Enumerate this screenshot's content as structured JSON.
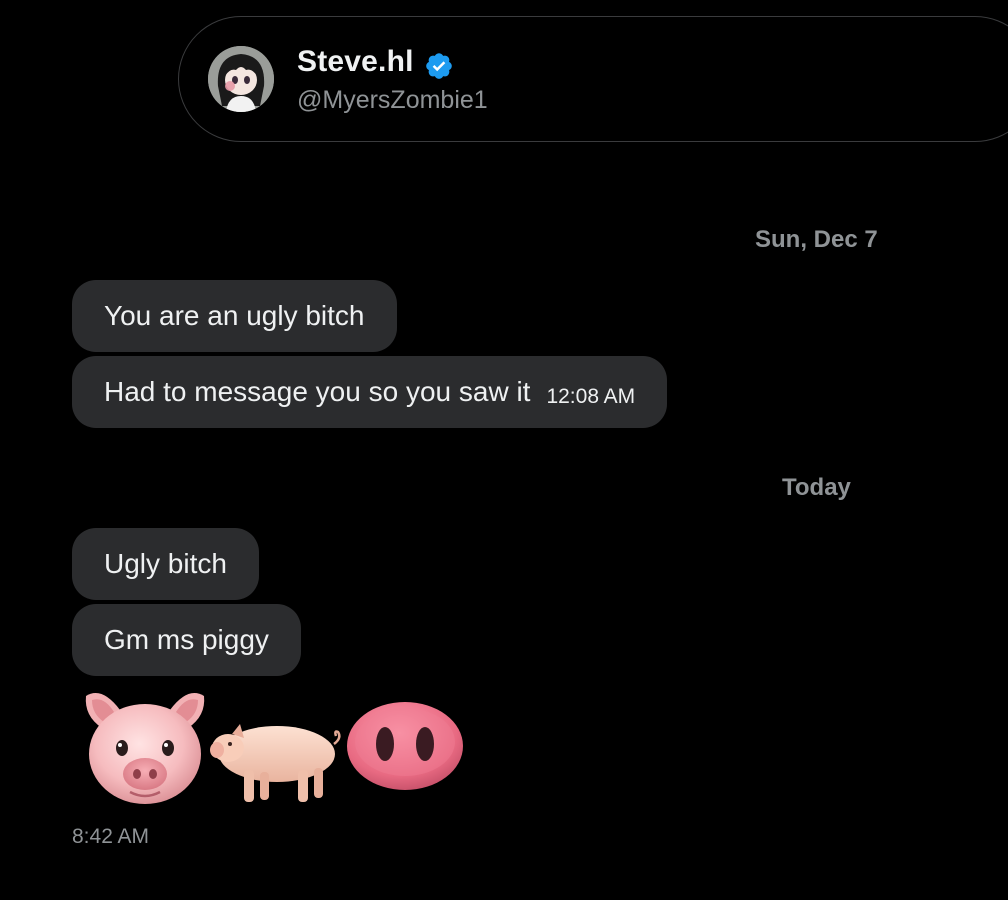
{
  "header": {
    "name": "Steve.hl",
    "handle": "@MyersZombie1",
    "verified_color": "#1d9bf0"
  },
  "thread": {
    "date_1": "Sun, Dec 7",
    "messages_1": [
      {
        "text": "You are an ugly bitch"
      },
      {
        "text": "Had to message you so you saw it",
        "time": "12:08 AM"
      }
    ],
    "date_2": "Today",
    "messages_2": [
      {
        "text": "Ugly bitch"
      },
      {
        "text": "Gm ms piggy"
      }
    ],
    "emoji_message": [
      "pig-face-emoji",
      "pig-emoji",
      "pig-nose-emoji"
    ],
    "emoji_time": "8:42 AM"
  },
  "colors": {
    "background": "#000000",
    "bubble": "#2b2c2e",
    "muted_text": "#8f9396"
  }
}
